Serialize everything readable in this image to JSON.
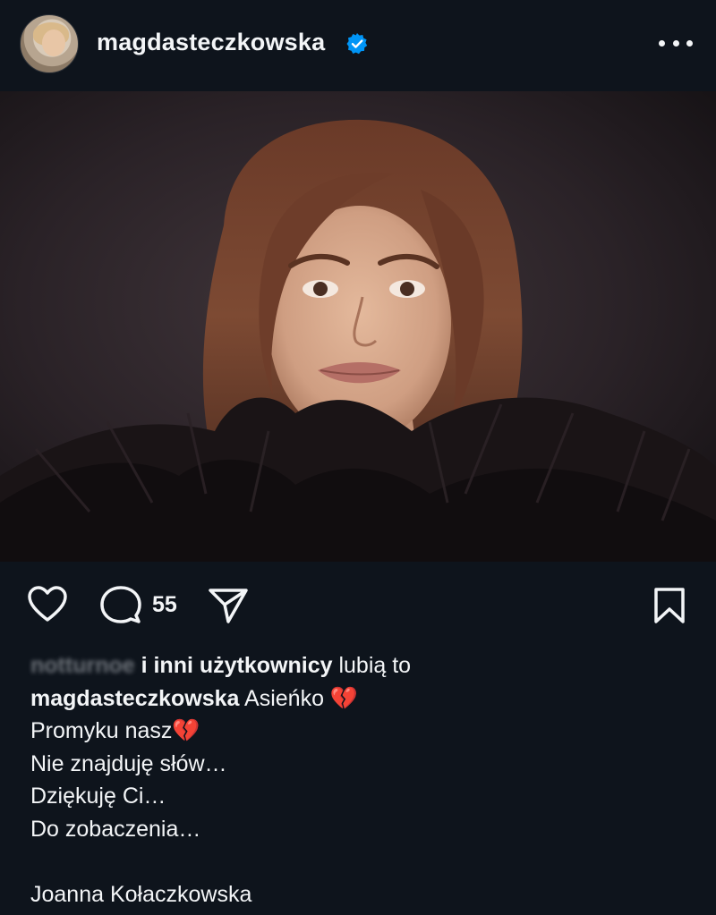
{
  "post": {
    "username": "magdasteczkowska",
    "verified": true,
    "comment_count": "55",
    "liked_by_name": "notturnoe",
    "liked_by_suffix": "i inni użytkownicy",
    "liked_by_tail": "lubią to",
    "caption_first": "Asieńko 💔",
    "caption_lines": [
      "Promyku nasz💔",
      "Nie znajduję słów…",
      "Dziękuję Ci…",
      "Do zobaczenia…",
      "",
      "Joanna Kołaczkowska"
    ]
  },
  "icons": {
    "avatar": "avatar",
    "verified": "verified-badge-icon",
    "more": "more-options-icon",
    "like": "heart-icon",
    "comment": "comment-icon",
    "share": "send-icon",
    "save": "bookmark-icon"
  },
  "colors": {
    "background": "#0e141c",
    "text": "#f3f5f7",
    "verified": "#0095f6"
  }
}
